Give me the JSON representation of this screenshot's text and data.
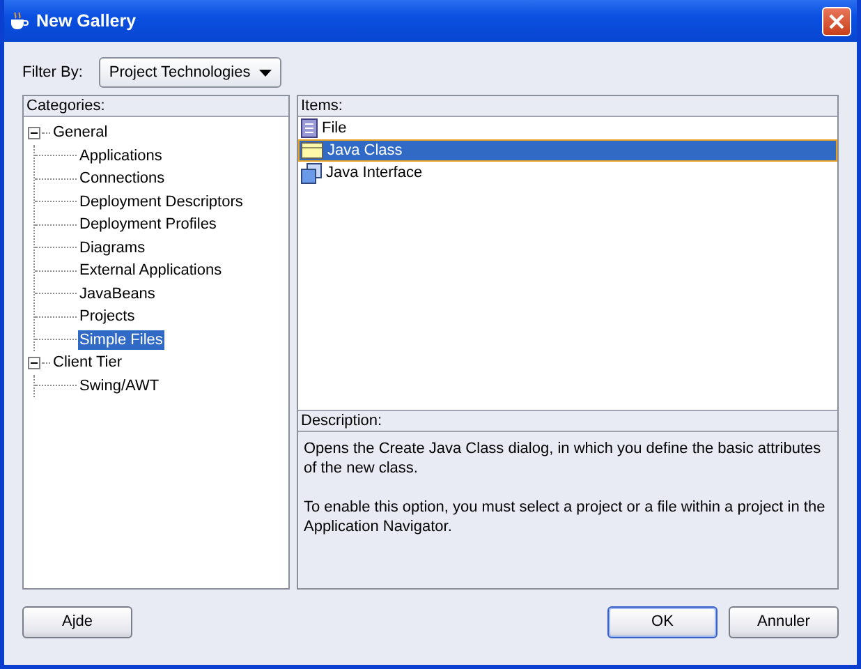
{
  "window": {
    "title": "New Gallery"
  },
  "filter": {
    "label": "Filter By:",
    "value": "Project Technologies"
  },
  "categories": {
    "heading": "Categories:",
    "tree": [
      {
        "label": "General",
        "expanded": true,
        "selected": false,
        "children": [
          {
            "label": "Applications",
            "selected": false
          },
          {
            "label": "Connections",
            "selected": false
          },
          {
            "label": "Deployment Descriptors",
            "selected": false
          },
          {
            "label": "Deployment Profiles",
            "selected": false
          },
          {
            "label": "Diagrams",
            "selected": false
          },
          {
            "label": "External Applications",
            "selected": false
          },
          {
            "label": "JavaBeans",
            "selected": false
          },
          {
            "label": "Projects",
            "selected": false
          },
          {
            "label": "Simple Files",
            "selected": true
          }
        ]
      },
      {
        "label": "Client Tier",
        "expanded": true,
        "selected": false,
        "children": [
          {
            "label": "Swing/AWT",
            "selected": false
          }
        ]
      }
    ]
  },
  "items": {
    "heading": "Items:",
    "list": [
      {
        "label": "File",
        "kind": "file",
        "selected": false
      },
      {
        "label": "Java Class",
        "kind": "class",
        "selected": true
      },
      {
        "label": "Java Interface",
        "kind": "interface",
        "selected": false
      }
    ]
  },
  "description": {
    "heading": "Description:",
    "paragraphs": [
      "Opens the Create Java Class dialog, in which you define the basic attributes of the new class.",
      "To enable this option, you must select a project or a file within a project in the Application Navigator."
    ]
  },
  "buttons": [
    {
      "label": "Ajde",
      "kind": "help",
      "default": false
    },
    {
      "label": "OK",
      "kind": "action",
      "default": true
    },
    {
      "label": "Annuler",
      "kind": "action",
      "default": false
    }
  ]
}
